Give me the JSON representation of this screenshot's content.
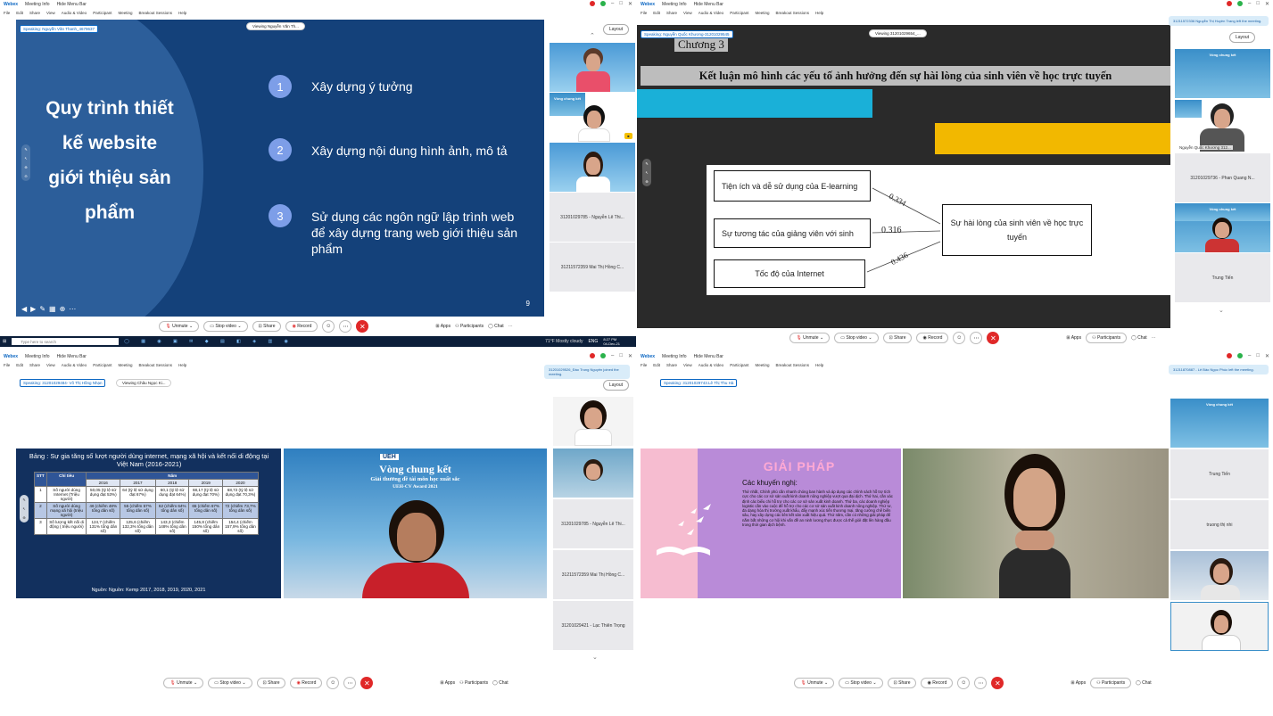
{
  "common": {
    "app_name": "Webex",
    "meeting_info": "Meeting Info",
    "hide_menu_bar": "Hide Menu Bar",
    "menu": [
      "File",
      "Edit",
      "Share",
      "View",
      "Audio & Video",
      "Participant",
      "Meeting",
      "Breakout Sessions",
      "Help"
    ],
    "layout_label": "Layout",
    "unmute": "Unmute",
    "stop_video": "Stop video",
    "share": "Share",
    "record": "Record",
    "apps": "Apps",
    "participants": "Participants",
    "chat": "Chat"
  },
  "q1": {
    "speaking": "Speaking: Nguyễn Văn Thanh_4679637",
    "viewing": "Viewing Nguyễn Văn Th...",
    "slide_title": "Quy trình thiết kế website giới thiệu sản phẩm",
    "steps": [
      {
        "n": "1",
        "text": "Xây dựng ý tưởng"
      },
      {
        "n": "2",
        "text": "Xây dựng nội dung hình ảnh, mô tả"
      },
      {
        "n": "3",
        "text": "Sử dụng các ngôn ngữ lập trình web để xây dựng trang web giới thiệu sản phẩm"
      }
    ],
    "page_number": "9",
    "tiles": [
      "31201029785 - Nguyễn Lê Thi...",
      "31211572359 Mai Thị Hồng C..."
    ],
    "taskbar_search": "Type here to search",
    "weather": "71°F Mostly cloudy",
    "clock_time": "8:27 PM",
    "clock_date": "04-Dec-21",
    "lang": "ENG"
  },
  "q2": {
    "speaking": "Speaking: Nguyễn Quốc Khương-31201029545",
    "viewing": "Viewing 31201029654_...",
    "notif": "31211572336 Nguyễn Thị Huyền Trang left the meeting.",
    "chuong": "Chương 3",
    "headline": "Kết luận mô hình các yếu tố ảnh hưởng đến sự hài lòng của sinh viên về học trực tuyến",
    "box1": "Tiện ích và dễ sử dụng của E-learning",
    "box2": "Sự tương tác của giảng viên với sinh",
    "box3": "Tốc độ của Internet",
    "box_result": "Sự hài lòng của sinh viên về học trực tuyến",
    "coef1": "0.334",
    "coef2": "0.316",
    "coef3": "0.436",
    "tiles": [
      "Nguyễn Quốc Khương 312...",
      "31201029736 - Phan Quang N...",
      "Trung Tiến"
    ]
  },
  "q3": {
    "speaking": "Speaking: 31201029484- Võ Thị Hồng Nhạn",
    "viewing": "Viewing Châu Ngọc Ki...",
    "notif": "31201029526_Đào Trung Nguyên joined the meeting.",
    "table_title": "Bảng : Sự gia tăng số lượt người dùng internet, mạng xã hội và kết nối di động tại Việt Nam (2016-2021)",
    "table_head": [
      "STT",
      "Chỉ tiêu",
      "Năm"
    ],
    "years": [
      "2016",
      "2017",
      "2018",
      "2019",
      "2020"
    ],
    "rows": [
      {
        "stt": "1",
        "label": "Số người dùng Internet (Triệu người)",
        "vals": [
          "50,05 (tỷ lệ sử dụng đạt 53%)",
          "64 (tỷ lệ sử dụng đạt 67%)",
          "60,1 (tỷ lệ sử dụng đạt 64%)",
          "68,17 (tỷ lệ sử dụng đạt 70%)",
          "68,72 (tỷ lệ sử dụng đạt 70,3%)"
        ]
      },
      {
        "stt": "2",
        "label": "Số người dùng mạng xã hội (triệu người)",
        "vals": [
          "46 (chiếm 48% tổng dân số)",
          "55 (chiếm 57% tổng dân số)",
          "62 (chiếm 64% tổng dân số)",
          "65 (chiếm 67% tổng dân số)",
          "72 (chiếm 73,7% tổng dân số)"
        ]
      },
      {
        "stt": "3",
        "label": "Số lượng kết nối di động ( triệu người)",
        "vals": [
          "124,7 (chiếm 131% tổng dân số)",
          "125,6 (chiếm 132,3% tổng dân số)",
          "143,3 (chiếm 148% tổng dân số)",
          "145,8 (chiếm 150% tổng dân số)",
          "154,4 (chiếm 157,9% tổng dân số)"
        ]
      }
    ],
    "source": "Nguồn: Nguồn: Kemp 2017, 2018, 2019, 2020, 2021",
    "banner_brand": "UEH",
    "banner_title": "Vòng chung kết",
    "banner_sub": "Giải thưởng đề tài môn học xuất sắc",
    "banner_award": "UEH-CV Award 2021",
    "tiles": [
      "31201029785 - Nguyễn Lê Thi...",
      "31211572359 Mai Thị Hồng C...",
      "31201029421 - Lạc Thiên Trọng"
    ]
  },
  "q4": {
    "speaking": "Speaking: 31201029743.Lê Thị Thu Hà",
    "notif": "31211870887 - Lê Bảo Ngọc Phúc left the meeting.",
    "slide_title": "GIẢI PHÁP",
    "sub": "Các khuyến nghị:",
    "body": "Thứ nhất, Chính phủ cần nhanh chóng ban hành và áp dụng các chính sách hỗ trợ tích cực cho các cơ sở sản xuất kinh doanh nông nghiệp vượt qua đại dịch. Thứ hai, cần xác định các biểu chi hỗ trợ cho các cơ sở sản xuất kinh doanh. Thứ ba, các doanh nghiệp logistic cần vào cuộc để hỗ trợ cho các cơ sở sản xuất kinh doanh nông nghiệp. Thứ tư, đa dạng hóa thị trường xuất khẩu, đẩy mạnh xúc tiến thương mại, tăng cường chế biến sâu, hay xây dựng các liên kết sản xuất hiệu quả. Thứ năm, cần có những giải pháp để nắm bắt những cơ hội khi vấn đề an ninh lương thực được cả thế giới đặt lên hàng đầu trong thời gian dịch bệnh.",
    "tiles": [
      "Trung Tiến",
      "truong thị nhi"
    ]
  }
}
